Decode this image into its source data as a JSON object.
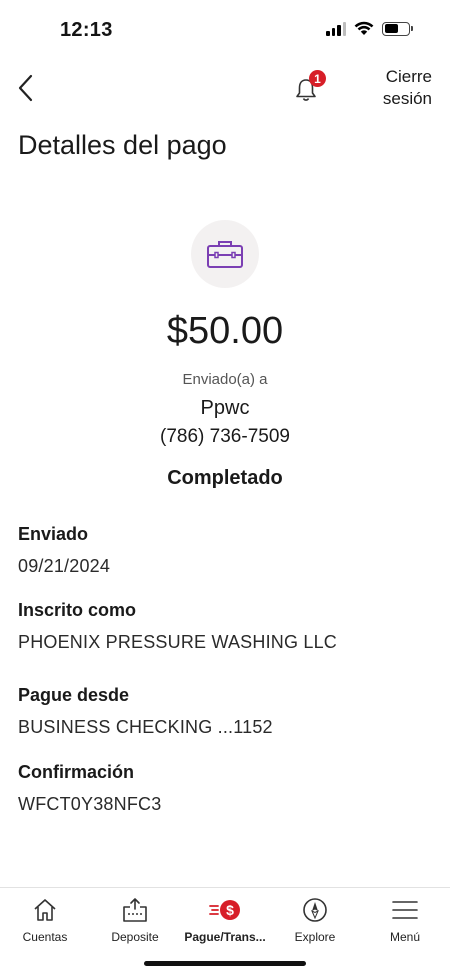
{
  "status_bar": {
    "time": "12:13"
  },
  "header": {
    "notification_count": "1",
    "logout_line1": "Cierre",
    "logout_line2": "sesión"
  },
  "page": {
    "title": "Detalles del pago"
  },
  "payment": {
    "icon": "briefcase-icon",
    "amount": "$50.00",
    "sent_to_label": "Enviado(a) a",
    "recipient_name": "Ppwc",
    "recipient_phone": "(786) 736-7509",
    "status": "Completado"
  },
  "details": [
    {
      "label": "Enviado",
      "value": "09/21/2024"
    },
    {
      "label": "Inscrito como",
      "value": "PHOENIX PRESSURE WASHING LLC"
    },
    {
      "label": "Pague desde",
      "value": "BUSINESS CHECKING ...1152"
    },
    {
      "label": "Confirmación",
      "value": "WFCT0Y38NFC3"
    }
  ],
  "bottom_nav": [
    {
      "label": "Cuentas",
      "icon": "home-icon",
      "active": false
    },
    {
      "label": "Deposite",
      "icon": "deposit-icon",
      "active": false
    },
    {
      "label": "Pague/Trans...",
      "icon": "pay-transfer-icon",
      "active": true
    },
    {
      "label": "Explore",
      "icon": "compass-icon",
      "active": false
    },
    {
      "label": "Menú",
      "icon": "menu-icon",
      "active": false
    }
  ],
  "colors": {
    "brand_red": "#d71e28",
    "icon_purple": "#7b3fb3",
    "icon_circle_bg": "#f3f1f1"
  }
}
